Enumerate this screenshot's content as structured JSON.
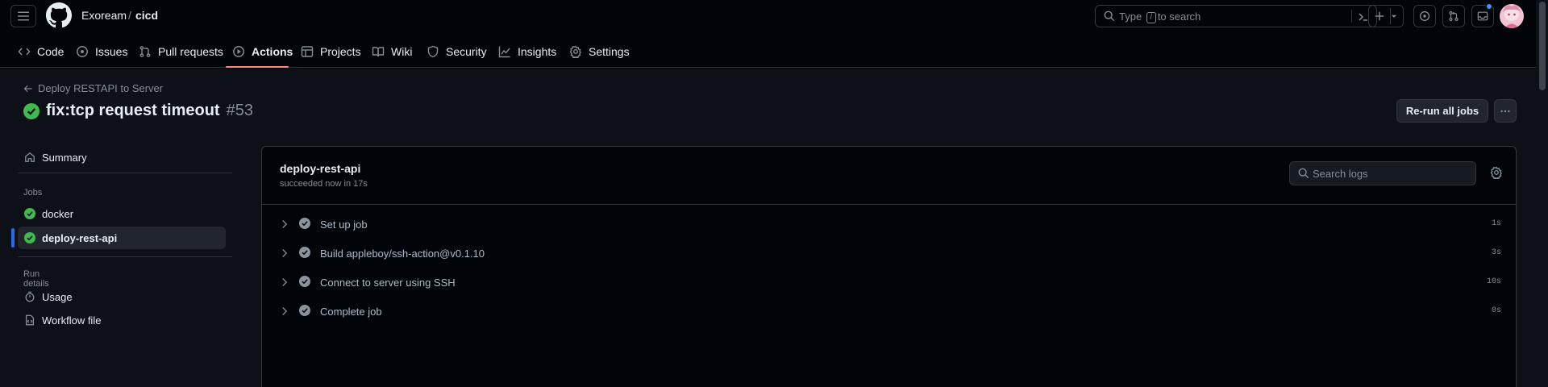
{
  "header": {
    "owner": "Exoream",
    "separator": "/",
    "repo": "cicd",
    "search": {
      "prefix": "Type",
      "key": "/",
      "suffix": "to search"
    }
  },
  "repo_tabs": [
    {
      "label": "Code",
      "icon": "code-icon"
    },
    {
      "label": "Issues",
      "icon": "issue-icon"
    },
    {
      "label": "Pull requests",
      "icon": "pull-request-icon"
    },
    {
      "label": "Actions",
      "icon": "play-icon",
      "active": true
    },
    {
      "label": "Projects",
      "icon": "table-icon"
    },
    {
      "label": "Wiki",
      "icon": "book-icon"
    },
    {
      "label": "Security",
      "icon": "shield-icon"
    },
    {
      "label": "Insights",
      "icon": "graph-icon"
    },
    {
      "label": "Settings",
      "icon": "gear-icon"
    }
  ],
  "run": {
    "back_label": "Deploy RESTAPI to Server",
    "title": "fix:tcp request timeout",
    "number": "#53",
    "rerun_label": "Re-run all jobs"
  },
  "sidebar": {
    "summary_label": "Summary",
    "jobs_heading": "Jobs",
    "jobs": [
      {
        "label": "docker",
        "status": "success"
      },
      {
        "label": "deploy-rest-api",
        "status": "success",
        "active": true
      }
    ],
    "run_details_heading": "Run details",
    "usage_label": "Usage",
    "workflow_file_label": "Workflow file"
  },
  "job": {
    "name": "deploy-rest-api",
    "status_text": "succeeded now in 17s",
    "search_placeholder": "Search logs",
    "steps": [
      {
        "name": "Set up job",
        "duration": "1s"
      },
      {
        "name": "Build appleboy/ssh-action@v0.1.10",
        "duration": "3s"
      },
      {
        "name": "Connect to server using SSH",
        "duration": "10s"
      },
      {
        "name": "Complete job",
        "duration": "0s"
      }
    ]
  },
  "colors": {
    "success": "#3fb950",
    "accent": "#fd8c73",
    "active_marker": "#1f6feb",
    "notification": "#4493f8"
  }
}
